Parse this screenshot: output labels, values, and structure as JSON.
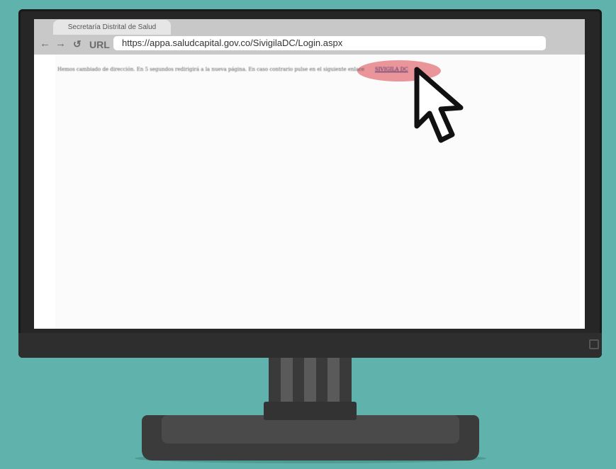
{
  "browser": {
    "tab_title": "Secretaría Distrital de Salud",
    "url_label": "URL",
    "url": "https://appa.saludcapital.gov.co/SivigilaDC/Login.aspx",
    "back_icon": "←",
    "forward_icon": "→",
    "reload_icon": "↺"
  },
  "page": {
    "message": "Hemos cambiado de dirección. En 5 segundos redirigirá a la nueva página. En caso contrario pulse en el siguiente enlace",
    "link_text": "SIVIGILA DC"
  },
  "colors": {
    "background": "#5fb3ac",
    "highlight": "#e88a8f",
    "monitor": "#262626"
  },
  "icons": [
    "arrow-left-icon",
    "arrow-right-icon",
    "reload-icon",
    "mouse-pointer-icon"
  ]
}
